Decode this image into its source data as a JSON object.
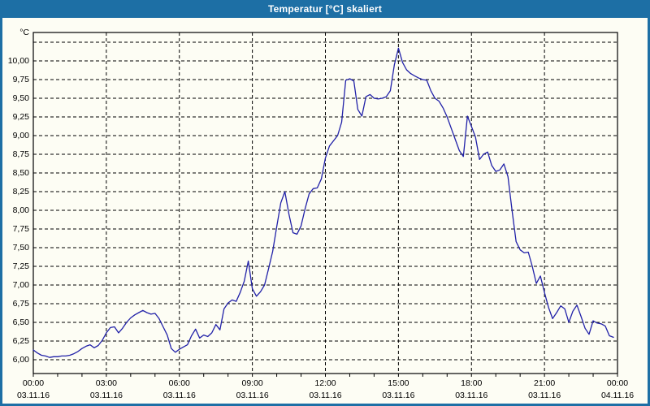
{
  "window": {
    "title": "Temperatur [°C] skaliert",
    "colors": {
      "titlebar": "#1d6fa5",
      "titlebar_text": "#ffffff",
      "frame": "#1d6fa5",
      "background": "#fdfdf4",
      "axis": "#000000",
      "grid": "#000000",
      "label_text": "#000000",
      "series_line": "#2121a8"
    }
  },
  "chart_data": {
    "type": "line",
    "title": "Temperatur [°C] skaliert",
    "y_unit_label": "°C",
    "ylim": [
      5.815,
      10.38
    ],
    "xlim_minutes": [
      0,
      1440
    ],
    "grid": "dashed horizontal and vertical",
    "legend": "none",
    "y_ticks": [
      {
        "value": 6.0,
        "label": "6,00"
      },
      {
        "value": 6.25,
        "label": "6,25"
      },
      {
        "value": 6.5,
        "label": "6,50"
      },
      {
        "value": 6.75,
        "label": "6,75"
      },
      {
        "value": 7.0,
        "label": "7,00"
      },
      {
        "value": 7.25,
        "label": "7,25"
      },
      {
        "value": 7.5,
        "label": "7,50"
      },
      {
        "value": 7.75,
        "label": "7,75"
      },
      {
        "value": 8.0,
        "label": "8,00"
      },
      {
        "value": 8.25,
        "label": "8,25"
      },
      {
        "value": 8.5,
        "label": "8,50"
      },
      {
        "value": 8.75,
        "label": "8,75"
      },
      {
        "value": 9.0,
        "label": "9,00"
      },
      {
        "value": 9.25,
        "label": "9,25"
      },
      {
        "value": 9.5,
        "label": "9,50"
      },
      {
        "value": 9.75,
        "label": "9,75"
      },
      {
        "value": 10.0,
        "label": "10,00"
      },
      {
        "value": 10.25,
        "label": ""
      }
    ],
    "x_ticks": [
      {
        "minutes": 0,
        "time": "00:00",
        "date": "03.11.16"
      },
      {
        "minutes": 180,
        "time": "03:00",
        "date": "03.11.16"
      },
      {
        "minutes": 360,
        "time": "06:00",
        "date": "03.11.16"
      },
      {
        "minutes": 540,
        "time": "09:00",
        "date": "03.11.16"
      },
      {
        "minutes": 720,
        "time": "12:00",
        "date": "03.11.16"
      },
      {
        "minutes": 900,
        "time": "15:00",
        "date": "03.11.16"
      },
      {
        "minutes": 1080,
        "time": "18:00",
        "date": "03.11.16"
      },
      {
        "minutes": 1260,
        "time": "21:00",
        "date": "03.11.16"
      },
      {
        "minutes": 1440,
        "time": "00:00",
        "date": "04.11.16"
      }
    ],
    "minor_x_tick_every_minutes": 60,
    "series": [
      {
        "name": "Temperatur",
        "color": "#2121a8",
        "points_min_val": [
          [
            0,
            6.13
          ],
          [
            10,
            6.09
          ],
          [
            20,
            6.06
          ],
          [
            30,
            6.05
          ],
          [
            40,
            6.03
          ],
          [
            50,
            6.04
          ],
          [
            60,
            6.04
          ],
          [
            70,
            6.05
          ],
          [
            80,
            6.05
          ],
          [
            90,
            6.06
          ],
          [
            100,
            6.08
          ],
          [
            110,
            6.11
          ],
          [
            120,
            6.15
          ],
          [
            130,
            6.18
          ],
          [
            140,
            6.2
          ],
          [
            150,
            6.16
          ],
          [
            160,
            6.19
          ],
          [
            170,
            6.26
          ],
          [
            180,
            6.36
          ],
          [
            190,
            6.43
          ],
          [
            200,
            6.44
          ],
          [
            210,
            6.36
          ],
          [
            220,
            6.42
          ],
          [
            230,
            6.5
          ],
          [
            240,
            6.56
          ],
          [
            250,
            6.6
          ],
          [
            260,
            6.63
          ],
          [
            270,
            6.66
          ],
          [
            280,
            6.63
          ],
          [
            290,
            6.61
          ],
          [
            300,
            6.62
          ],
          [
            310,
            6.55
          ],
          [
            320,
            6.44
          ],
          [
            330,
            6.33
          ],
          [
            340,
            6.15
          ],
          [
            350,
            6.1
          ],
          [
            360,
            6.14
          ],
          [
            370,
            6.17
          ],
          [
            380,
            6.2
          ],
          [
            390,
            6.32
          ],
          [
            400,
            6.41
          ],
          [
            410,
            6.29
          ],
          [
            420,
            6.33
          ],
          [
            430,
            6.31
          ],
          [
            440,
            6.36
          ],
          [
            450,
            6.47
          ],
          [
            460,
            6.4
          ],
          [
            470,
            6.68
          ],
          [
            480,
            6.76
          ],
          [
            490,
            6.8
          ],
          [
            500,
            6.78
          ],
          [
            510,
            6.9
          ],
          [
            520,
            7.05
          ],
          [
            530,
            7.32
          ],
          [
            540,
            6.95
          ],
          [
            550,
            6.85
          ],
          [
            560,
            6.91
          ],
          [
            570,
            7.0
          ],
          [
            580,
            7.22
          ],
          [
            590,
            7.45
          ],
          [
            600,
            7.78
          ],
          [
            610,
            8.1
          ],
          [
            620,
            8.25
          ],
          [
            630,
            7.95
          ],
          [
            640,
            7.7
          ],
          [
            650,
            7.68
          ],
          [
            660,
            7.79
          ],
          [
            670,
            8.02
          ],
          [
            680,
            8.22
          ],
          [
            690,
            8.29
          ],
          [
            700,
            8.3
          ],
          [
            710,
            8.42
          ],
          [
            720,
            8.7
          ],
          [
            730,
            8.86
          ],
          [
            740,
            8.93
          ],
          [
            750,
            9.0
          ],
          [
            760,
            9.18
          ],
          [
            770,
            9.74
          ],
          [
            780,
            9.76
          ],
          [
            790,
            9.73
          ],
          [
            800,
            9.35
          ],
          [
            810,
            9.26
          ],
          [
            820,
            9.52
          ],
          [
            830,
            9.55
          ],
          [
            840,
            9.5
          ],
          [
            850,
            9.49
          ],
          [
            860,
            9.5
          ],
          [
            870,
            9.52
          ],
          [
            880,
            9.6
          ],
          [
            890,
            9.95
          ],
          [
            900,
            10.17
          ],
          [
            910,
            9.98
          ],
          [
            920,
            9.88
          ],
          [
            930,
            9.83
          ],
          [
            940,
            9.8
          ],
          [
            950,
            9.77
          ],
          [
            960,
            9.75
          ],
          [
            970,
            9.74
          ],
          [
            980,
            9.6
          ],
          [
            990,
            9.5
          ],
          [
            1000,
            9.46
          ],
          [
            1010,
            9.37
          ],
          [
            1020,
            9.25
          ],
          [
            1030,
            9.1
          ],
          [
            1040,
            8.95
          ],
          [
            1050,
            8.8
          ],
          [
            1060,
            8.72
          ],
          [
            1070,
            9.26
          ],
          [
            1080,
            9.12
          ],
          [
            1090,
            8.98
          ],
          [
            1100,
            8.68
          ],
          [
            1110,
            8.75
          ],
          [
            1120,
            8.78
          ],
          [
            1130,
            8.6
          ],
          [
            1140,
            8.52
          ],
          [
            1150,
            8.54
          ],
          [
            1160,
            8.62
          ],
          [
            1170,
            8.45
          ],
          [
            1180,
            8.0
          ],
          [
            1190,
            7.58
          ],
          [
            1200,
            7.47
          ],
          [
            1210,
            7.43
          ],
          [
            1220,
            7.44
          ],
          [
            1230,
            7.25
          ],
          [
            1240,
            7.02
          ],
          [
            1250,
            7.12
          ],
          [
            1260,
            6.9
          ],
          [
            1270,
            6.7
          ],
          [
            1280,
            6.55
          ],
          [
            1290,
            6.63
          ],
          [
            1300,
            6.72
          ],
          [
            1310,
            6.68
          ],
          [
            1320,
            6.5
          ],
          [
            1330,
            6.65
          ],
          [
            1340,
            6.73
          ],
          [
            1350,
            6.58
          ],
          [
            1360,
            6.42
          ],
          [
            1370,
            6.34
          ],
          [
            1380,
            6.52
          ],
          [
            1390,
            6.49
          ],
          [
            1400,
            6.48
          ],
          [
            1410,
            6.45
          ],
          [
            1420,
            6.32
          ],
          [
            1430,
            6.3
          ]
        ]
      }
    ]
  }
}
